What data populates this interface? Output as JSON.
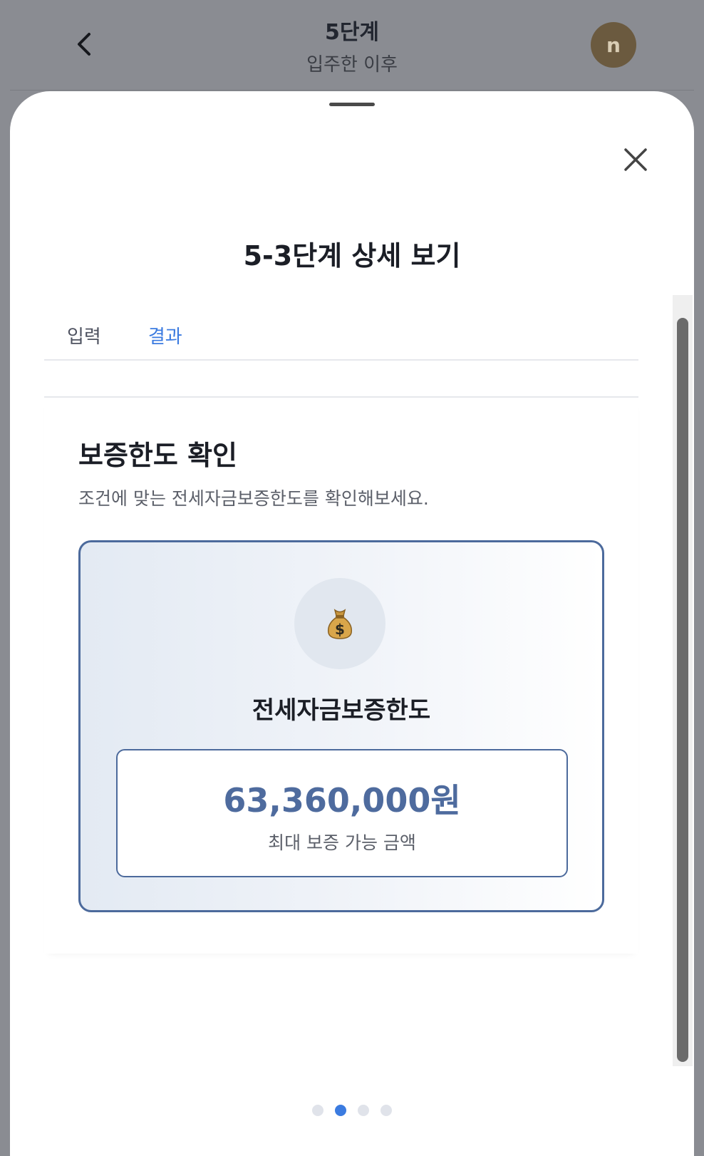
{
  "header": {
    "title": "5단계",
    "subtitle": "입주한 이후",
    "avatar_initial": "n"
  },
  "sheet": {
    "title": "5-3단계 상세 보기",
    "tabs": [
      {
        "label": "입력",
        "active": false
      },
      {
        "label": "결과",
        "active": true
      }
    ]
  },
  "result": {
    "heading": "보증한도 확인",
    "description": "조건에 맞는 전세자금보증한도를 확인해보세요.",
    "icon": "money-bag-icon",
    "card_label": "전세자금보증한도",
    "amount": "63,360,000원",
    "amount_caption": "최대 보증 가능 금액"
  },
  "pagination": {
    "total": 4,
    "current": 2
  },
  "colors": {
    "accent": "#3b7be0",
    "card_border": "#4c6a9c",
    "amount_text": "#4e6b9e"
  }
}
